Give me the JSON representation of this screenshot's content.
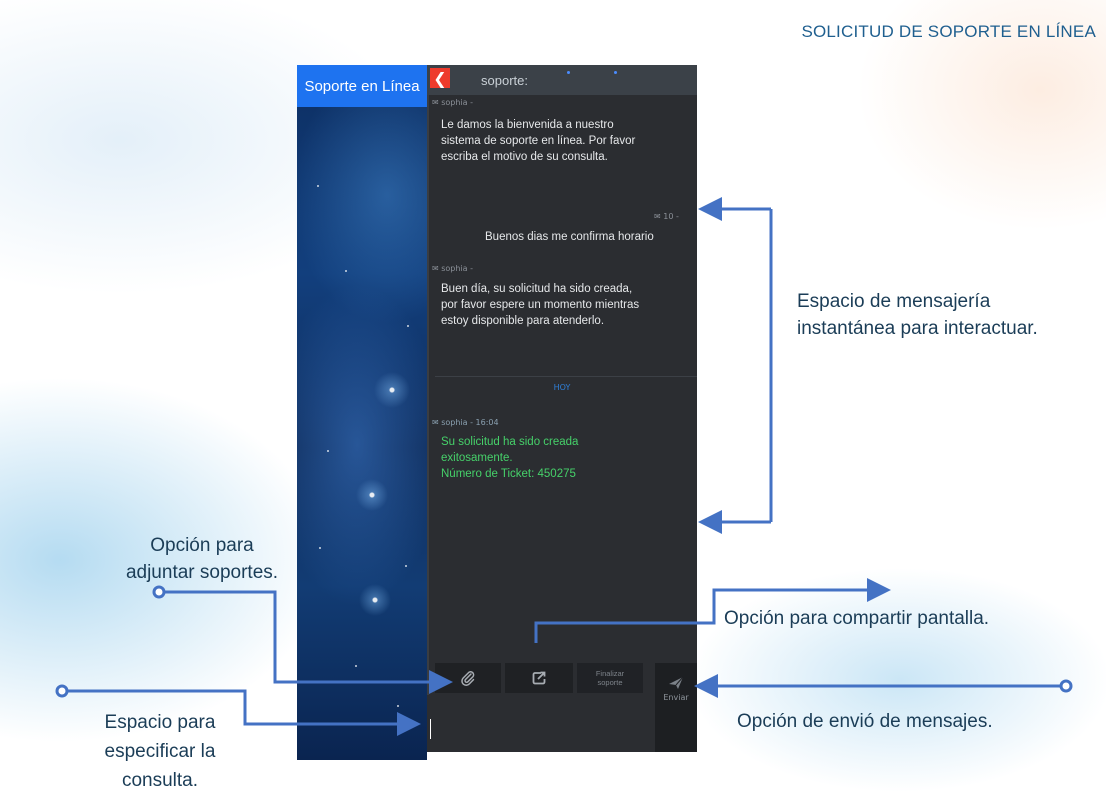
{
  "page": {
    "title": "SOLICITUD DE SOPORTE EN LÍNEA"
  },
  "sidebar": {
    "header": "Soporte en Línea"
  },
  "chat": {
    "title": "soporte:",
    "messages": [
      {
        "meta": "✉ sophia -",
        "text": "Le damos la bienvenida a nuestro sistema de soporte en línea. Por favor escriba el motivo de su consulta."
      },
      {
        "meta": "✉ 10 -",
        "text": "Buenos dias  me confirma horario"
      },
      {
        "meta": "✉ sophia -",
        "text": "Buen día, su solicitud ha sido creada, por favor espere un momento mientras estoy disponible para atenderlo."
      },
      {
        "meta": "✉ sophia - 16:04",
        "line1": "Su solicitud ha sido creada",
        "line2": "exitosamente.",
        "line3": "Número de Ticket: 450275"
      }
    ],
    "today_label": "HOY"
  },
  "toolbar": {
    "attach_icon": "paperclip-icon",
    "share_icon": "screen-share-icon",
    "finalize_label": "Finalizar soporte",
    "send_icon": "paper-plane-icon",
    "send_label": "Enviar"
  },
  "annotations": {
    "messaging": "Espacio de mensajería instantánea para interactuar.",
    "attach": "Opción para adjuntar soportes.",
    "share": "Opción para compartir pantalla.",
    "send": "Opción de envió de mensajes.",
    "query": "Espacio para especificar la consulta."
  },
  "colors": {
    "accent": "#1e73f0",
    "back_button": "#ee3b2c",
    "arrow": "#4472c4",
    "annotation_text": "#1b3d57",
    "system_message": "#46d16a"
  }
}
